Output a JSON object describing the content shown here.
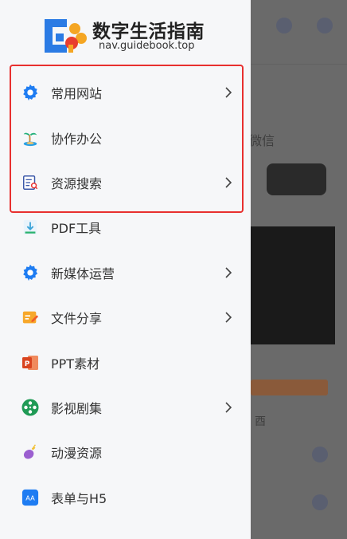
{
  "site": {
    "title": "数字生活指南",
    "domain": "nav.guidebook.top"
  },
  "menu": {
    "items": [
      {
        "label": "常用网站",
        "icon": "gear-icon",
        "has_submenu": true
      },
      {
        "label": "协作办公",
        "icon": "palm-island-icon",
        "has_submenu": false
      },
      {
        "label": "资源搜索",
        "icon": "document-search-icon",
        "has_submenu": true
      },
      {
        "label": "PDF工具",
        "icon": "pdf-download-icon",
        "has_submenu": false
      },
      {
        "label": "新媒体运营",
        "icon": "gear-icon",
        "has_submenu": true
      },
      {
        "label": "文件分享",
        "icon": "note-icon",
        "has_submenu": true
      },
      {
        "label": "PPT素材",
        "icon": "powerpoint-icon",
        "has_submenu": false
      },
      {
        "label": "影视剧集",
        "icon": "film-reel-icon",
        "has_submenu": true
      },
      {
        "label": "动漫资源",
        "icon": "eggplant-icon",
        "has_submenu": false
      },
      {
        "label": "表单与H5",
        "icon": "aa-font-icon",
        "has_submenu": false
      }
    ]
  },
  "background_page": {
    "text1": "微信",
    "text2": "酉"
  },
  "colors": {
    "drawer_bg": "#f6f7f9",
    "highlight_border": "#e8302f",
    "gear_blue": "#1e7cf2"
  }
}
